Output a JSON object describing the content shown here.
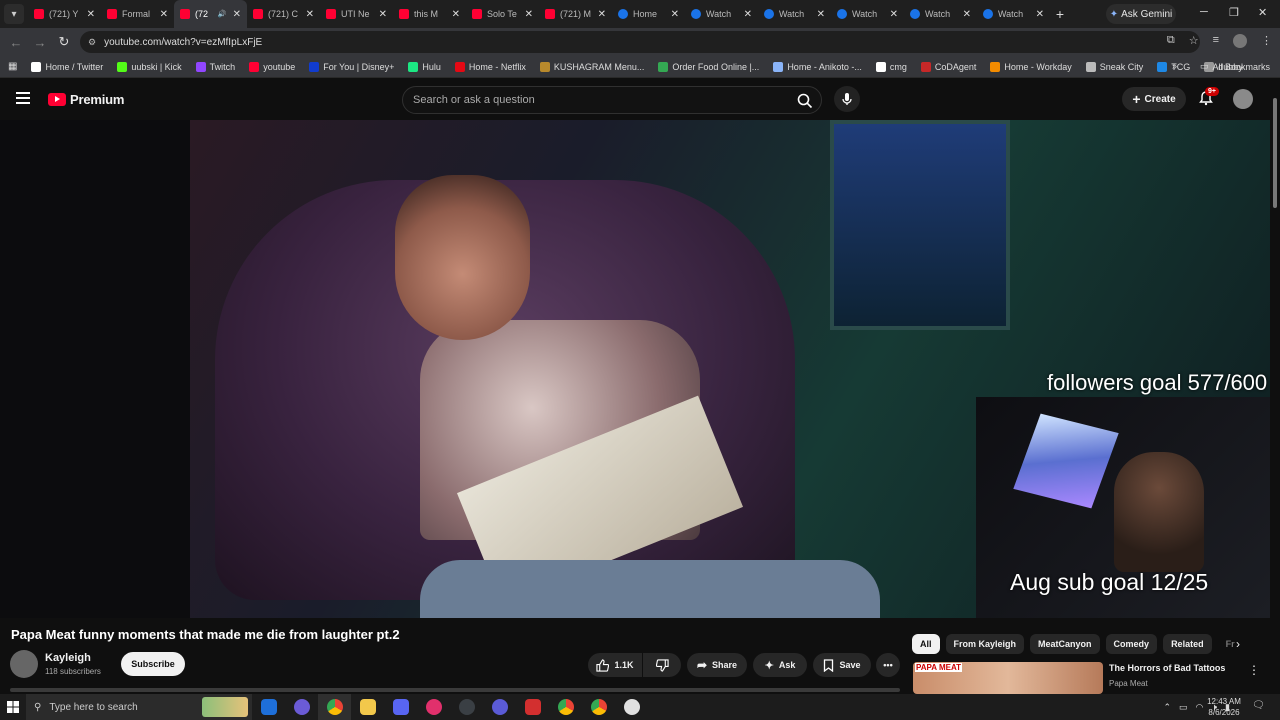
{
  "browser": {
    "tabs": [
      {
        "label": "(721) Y",
        "icon": "youtube-icon"
      },
      {
        "label": "Formal",
        "icon": "youtube-icon"
      },
      {
        "label": "(72",
        "icon": "youtube-icon",
        "active": true
      },
      {
        "label": "(721) C",
        "icon": "youtube-icon"
      },
      {
        "label": "UTI Ne",
        "icon": "youtube-icon"
      },
      {
        "label": "this M",
        "icon": "youtube-icon"
      },
      {
        "label": "Solo Te",
        "icon": "youtube-icon"
      },
      {
        "label": "(721) M",
        "icon": "youtube-icon"
      },
      {
        "label": "Home",
        "icon": "globe-icon"
      },
      {
        "label": "Watch",
        "icon": "globe-icon"
      },
      {
        "label": "Watch",
        "icon": "globe-icon"
      },
      {
        "label": "Watch",
        "icon": "globe-icon"
      },
      {
        "label": "Watch",
        "icon": "globe-icon"
      },
      {
        "label": "Watch",
        "icon": "globe-icon"
      }
    ],
    "gemini_label": "Ask Gemini",
    "url": "youtube.com/watch?v=ezMfIpLxFjE",
    "bookmarks": [
      {
        "label": "Home / Twitter",
        "color": "#ffffff"
      },
      {
        "label": "uubski | Kick",
        "color": "#53fc18"
      },
      {
        "label": "Twitch",
        "color": "#9146ff"
      },
      {
        "label": "youtube",
        "color": "#ff0033"
      },
      {
        "label": "For You | Disney+",
        "color": "#113ccf"
      },
      {
        "label": "Hulu",
        "color": "#1ce783"
      },
      {
        "label": "Home - Netflix",
        "color": "#e50914"
      },
      {
        "label": "KUSHAGRAM Menu...",
        "color": "#b8892c"
      },
      {
        "label": "Order Food Online |...",
        "color": "#34a853"
      },
      {
        "label": "Home - Anikoto -...",
        "color": "#8ab4f8"
      },
      {
        "label": "cmg",
        "color": "#ffffff"
      },
      {
        "label": "CoDAgent",
        "color": "#c62828"
      },
      {
        "label": "Home - Workday",
        "color": "#f38b00"
      },
      {
        "label": "Sneak City",
        "color": "#bbbbbb"
      },
      {
        "label": "TCG",
        "color": "#1e88e5"
      },
      {
        "label": "dubby",
        "color": "#999999"
      }
    ],
    "all_bookmarks": "All Bookmarks"
  },
  "youtube": {
    "logo": "Premium",
    "search_placeholder": "Search or ask a question",
    "create_label": "Create",
    "notif_badge": "9+",
    "overlay_followers": "followers goal 577/600",
    "overlay_subs": "Aug sub goal 12/25",
    "video_title": "Papa Meat funny moments that made me die from laughter pt.2",
    "channel_name": "Kayleigh",
    "channel_subs": "118 subscribers",
    "subscribe_label": "Subscribe",
    "likes": "1.1K",
    "share_label": "Share",
    "ask_label": "Ask",
    "save_label": "Save",
    "chips": [
      "All",
      "From Kayleigh",
      "MeatCanyon",
      "Comedy",
      "Related",
      "Fr"
    ],
    "rec_thumb_label": "PAPA MEAT",
    "rec_title": "The Horrors of Bad Tattoos",
    "rec_channel": "Papa Meat"
  },
  "taskbar": {
    "search_placeholder": "Type here to search",
    "time": "12:43 AM",
    "date": "8/6/2026"
  }
}
